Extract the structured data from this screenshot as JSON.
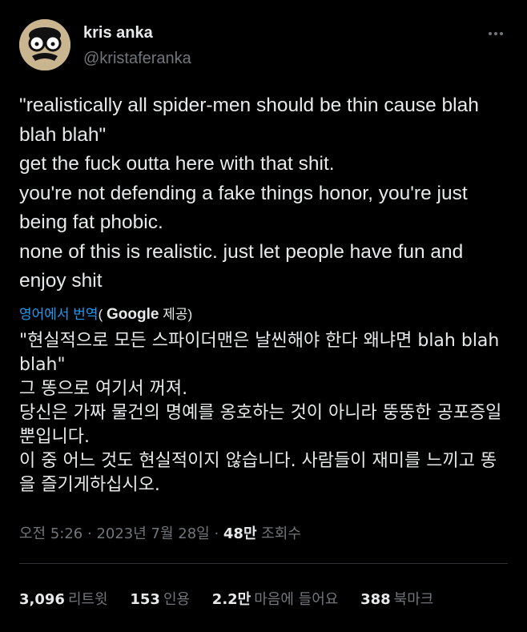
{
  "author": {
    "display_name": "kris anka",
    "handle": "@kristaferanka"
  },
  "more_icon": "more-horizontal-icon",
  "tweet": {
    "lines": [
      "\"realistically all spider-men should be thin cause blah blah blah\"",
      "get the fuck outta here with that shit.",
      "you're not defending a fake things honor, you're just being fat phobic.",
      "none of this is realistic. just let people have fun and enjoy shit"
    ]
  },
  "translation": {
    "link": "영어에서 번역",
    "open": "(",
    "provider": "Google",
    "suffix": " 제공)",
    "lines": [
      "\"현실적으로 모든 스파이더맨은 날씬해야 한다 왜냐면 blah blah blah\"",
      "그 똥으로 여기서 꺼져.",
      "당신은 가짜 물건의 명예를 옹호하는 것이 아니라 뚱뚱한 공포증일 뿐입니다.",
      "이 중 어느 것도 현실적이지 않습니다. 사람들이 재미를 느끼고 똥을 즐기게하십시오."
    ]
  },
  "meta": {
    "time": "오전 5:26",
    "sep1": " · ",
    "date": "2023년 7월 28일",
    "sep2": " · ",
    "views": "48만",
    "views_label": " 조회수"
  },
  "stats": {
    "retweets": {
      "num": "3,096",
      "label": "리트윗"
    },
    "quotes": {
      "num": "153",
      "label": "인용"
    },
    "likes": {
      "num": "2.2만",
      "label": "마음에 들어요"
    },
    "bookmarks": {
      "num": "388",
      "label": "북마크"
    }
  },
  "colors": {
    "background": "#000000",
    "text": "#e7e9ea",
    "secondary": "#71767b",
    "link": "#1d9bf0",
    "divider": "#2f3336"
  }
}
